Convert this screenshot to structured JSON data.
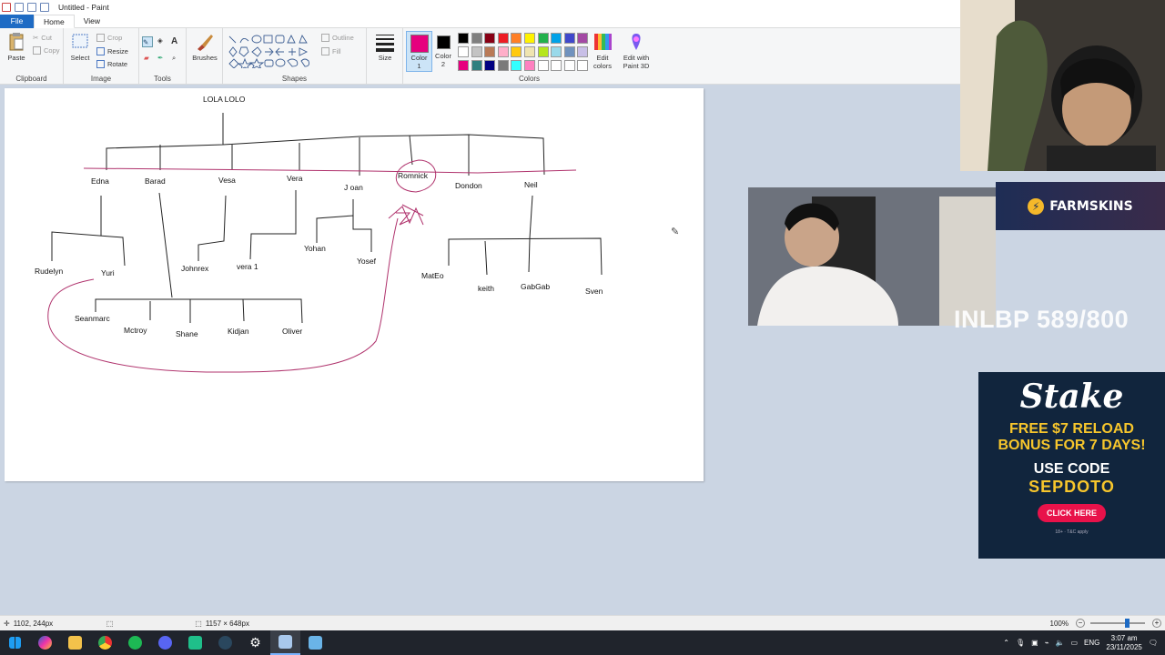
{
  "window": {
    "title": "Untitled - Paint"
  },
  "tabs": [
    {
      "label": "File"
    },
    {
      "label": "Home"
    },
    {
      "label": "View"
    }
  ],
  "ribbon": {
    "clipboard": {
      "label": "Clipboard",
      "paste": "Paste",
      "cut": "Cut",
      "copy": "Copy"
    },
    "image": {
      "label": "Image",
      "select": "Select",
      "crop": "Crop",
      "resize": "Resize",
      "rotate": "Rotate"
    },
    "tools": {
      "label": "Tools"
    },
    "brushes": {
      "label": "Brushes"
    },
    "shapes": {
      "label": "Shapes",
      "outline": "Outline",
      "fill": "Fill"
    },
    "size": {
      "label": "Size"
    },
    "colors": {
      "label": "Colors",
      "color1": "Color 1",
      "color2": "Color 2",
      "edit_colors": "Edit colors",
      "paint3d": "Edit with Paint 3D",
      "color1_value": "#e6007e",
      "color2_value": "#000000",
      "palette_row1": [
        "#000000",
        "#7f7f7f",
        "#880015",
        "#ed1c24",
        "#ff7f27",
        "#fff200",
        "#22b14c",
        "#00a2e8",
        "#3f48cc",
        "#a349a4"
      ],
      "palette_row2": [
        "#ffffff",
        "#c3c3c3",
        "#b97a57",
        "#ffaec9",
        "#ffc90e",
        "#efe4b0",
        "#b5e61d",
        "#99d9ea",
        "#7092be",
        "#c8bfe7"
      ],
      "palette_row3": [
        "#e6007e",
        "#2f7f7f",
        "#000080",
        "#7a7a7a",
        "#33ffff",
        "#ff80c0",
        "#ffffff",
        "#ffffff",
        "#ffffff",
        "#ffffff"
      ]
    }
  },
  "canvas": {
    "names": [
      {
        "text": "LOLA LOLO"
      },
      {
        "text": "Edna"
      },
      {
        "text": "Barad"
      },
      {
        "text": "Vesa"
      },
      {
        "text": "Vera"
      },
      {
        "text": "J oan"
      },
      {
        "text": "Romnick"
      },
      {
        "text": "Dondon"
      },
      {
        "text": "Neil"
      },
      {
        "text": "Rudelyn"
      },
      {
        "text": "Yuri"
      },
      {
        "text": "Johnrex"
      },
      {
        "text": "vera 1"
      },
      {
        "text": "Yohan"
      },
      {
        "text": "Yosef"
      },
      {
        "text": "MatEo"
      },
      {
        "text": "keith"
      },
      {
        "text": "GabGab"
      },
      {
        "text": "Sven"
      },
      {
        "text": "Seanmarc"
      },
      {
        "text": "Mctroy"
      },
      {
        "text": "Shane"
      },
      {
        "text": "Kidjan"
      },
      {
        "text": "Oliver"
      }
    ]
  },
  "statusbar": {
    "cursor": "1102, 244px",
    "size": "1157 × 648px",
    "zoom": "100%"
  },
  "taskbar": {
    "lang": "ENG",
    "time": "3:07 am",
    "date": "23/11/2025",
    "apps": [
      "windows-icon",
      "copilot-icon",
      "file-explorer-icon",
      "chrome-icon",
      "spotify-icon",
      "discord-icon",
      "app-icon",
      "steam-icon",
      "settings-icon",
      "paint-icon",
      "app2-icon"
    ]
  },
  "overlays": {
    "farmskins": "FARMSKINS",
    "bp_counter": "INLBP 589/800",
    "stake": {
      "logo": "Stake",
      "line1": "FREE $7 RELOAD",
      "line2": "BONUS FOR 7 DAYS!",
      "line3": "USE CODE",
      "code": "SEPDOTO",
      "button": "CLICK HERE",
      "fine": "18+ · T&C apply"
    }
  }
}
